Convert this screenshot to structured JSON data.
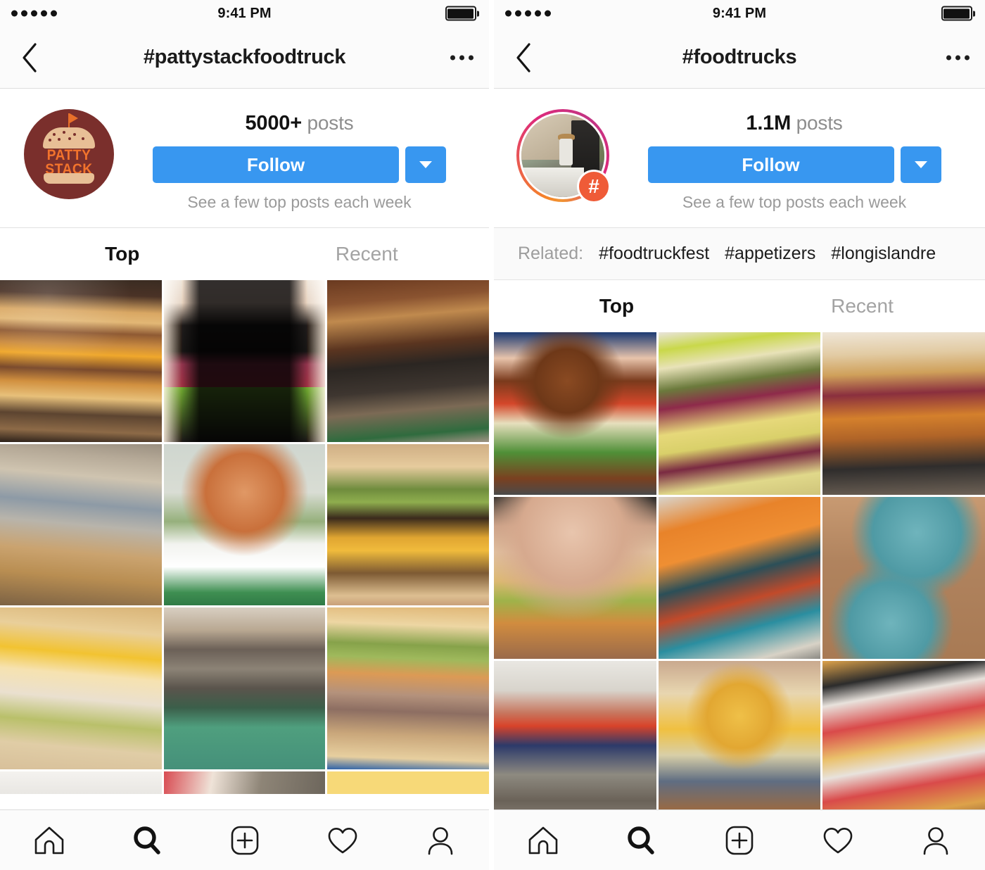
{
  "panels": [
    {
      "id": "pattystackfoodtruck",
      "status": {
        "carrier_dots": 5,
        "time": "9:41 PM",
        "battery": "full"
      },
      "nav": {
        "back_icon": "chevron-left-icon",
        "title": "#pattystackfoodtruck",
        "more_icon": "ellipsis-icon"
      },
      "profile": {
        "avatar_type": "logo",
        "logo": {
          "line1": "PATTY",
          "line2": "STACK",
          "bg": "#7a2f2c",
          "text_color": "#f2732c",
          "bun_color": "#e8bf96"
        },
        "post_count": "5000+",
        "post_label": "posts",
        "follow_label": "Follow",
        "follow_color": "#3897f0",
        "caret_icon": "chevron-down-icon",
        "subnote": "See a few top posts each week"
      },
      "related": null,
      "tabs": [
        {
          "label": "Top",
          "active": true
        },
        {
          "label": "Recent",
          "active": false
        }
      ],
      "grid": [
        {
          "alt": "towering stacked burger with fried egg on wooden board"
        },
        {
          "alt": "woman holding red and green smoothie cups"
        },
        {
          "alt": "cook working inside wooden food truck"
        },
        {
          "alt": "vendor serving customer at food truck window"
        },
        {
          "alt": "burger with brioche bun in white ceramic dish"
        },
        {
          "alt": "double cheeseburger with lettuce held in hand"
        },
        {
          "alt": "burger with runny egg yolk dripping"
        },
        {
          "alt": "hands scraping griddle with spatulas"
        },
        {
          "alt": "sesame bun burger with pickles and sweet potato"
        },
        {
          "alt": "white plate closeup"
        },
        {
          "alt": "fries basket on picnic table"
        },
        {
          "alt": "yellow surface"
        }
      ],
      "tabbar": [
        {
          "icon": "home-icon",
          "active": false
        },
        {
          "icon": "search-icon",
          "active": true
        },
        {
          "icon": "add-post-icon",
          "active": false
        },
        {
          "icon": "heart-icon",
          "active": false
        },
        {
          "icon": "profile-icon",
          "active": false
        }
      ]
    },
    {
      "id": "foodtrucks",
      "status": {
        "carrier_dots": 5,
        "time": "9:41 PM",
        "battery": "full"
      },
      "nav": {
        "back_icon": "chevron-left-icon",
        "title": "#foodtrucks",
        "more_icon": "ellipsis-icon"
      },
      "profile": {
        "avatar_type": "hashtag-photo",
        "badge": "#",
        "badge_color": "#ef5b37",
        "post_count": "1.1M",
        "post_label": "posts",
        "follow_label": "Follow",
        "follow_color": "#3897f0",
        "caret_icon": "chevron-down-icon",
        "subnote": "See a few top posts each week"
      },
      "related": {
        "label": "Related:",
        "tags": [
          "#foodtruckfest",
          "#appetizers",
          "#longislandre"
        ]
      },
      "tabs": [
        {
          "label": "Top",
          "active": true
        },
        {
          "label": "Recent",
          "active": false
        }
      ],
      "grid": [
        {
          "alt": "hands holding cheeseburger with tomato jam and lettuce"
        },
        {
          "alt": "two chicken tacos with cabbage and radish"
        },
        {
          "alt": "fried chicken sandwich on sesame bun on slate"
        },
        {
          "alt": "woman biting into a sesame seed burger"
        },
        {
          "alt": "couple ordering at orange and teal food truck"
        },
        {
          "alt": "overhead tacos on blue plates with salsa bowl"
        },
        {
          "alt": "couple sitting on bench eating sandwiches"
        },
        {
          "alt": "hands holding burger with yolk dripping onto blue plate"
        },
        {
          "alt": "hot dogs curly fries and onion rings in checkered baskets"
        }
      ],
      "tabbar": [
        {
          "icon": "home-icon",
          "active": false
        },
        {
          "icon": "search-icon",
          "active": true
        },
        {
          "icon": "add-post-icon",
          "active": false
        },
        {
          "icon": "heart-icon",
          "active": false
        },
        {
          "icon": "profile-icon",
          "active": false
        }
      ]
    }
  ]
}
